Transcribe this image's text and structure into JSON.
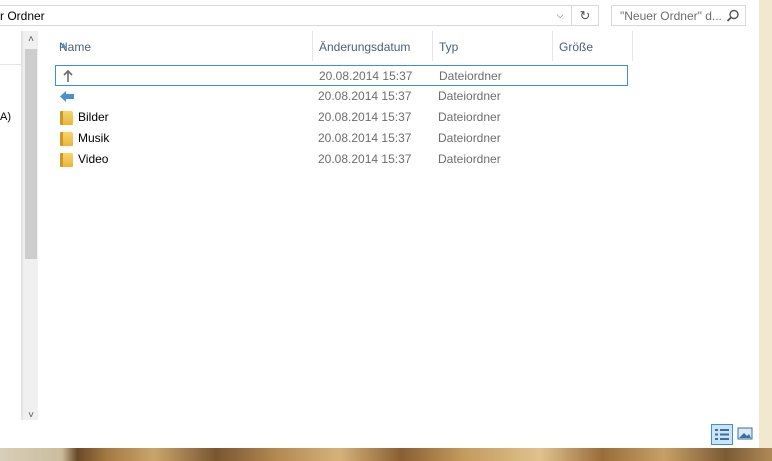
{
  "address": {
    "path_text": "r Ordner"
  },
  "search": {
    "placeholder": "\"Neuer Ordner\" d..."
  },
  "nav": {
    "partial_label": "A)"
  },
  "columns": [
    {
      "label": "Name"
    },
    {
      "label": "Änderungsdatum"
    },
    {
      "label": "Typ"
    },
    {
      "label": "Größe"
    }
  ],
  "rows": [
    {
      "name": "",
      "date": "20.08.2014 15:37",
      "type": "Dateiordner",
      "icon": "up-arrow-icon"
    },
    {
      "name": "",
      "date": "20.08.2014 15:37",
      "type": "Dateiordner",
      "icon": "back-arrow-icon"
    },
    {
      "name": "Bilder",
      "date": "20.08.2014 15:37",
      "type": "Dateiordner",
      "icon": "folder-icon"
    },
    {
      "name": "Musik",
      "date": "20.08.2014 15:37",
      "type": "Dateiordner",
      "icon": "folder-icon"
    },
    {
      "name": "Video",
      "date": "20.08.2014 15:37",
      "type": "Dateiordner",
      "icon": "folder-icon"
    }
  ],
  "colors": {
    "accent": "#3c8fdb",
    "header_text": "#4c607a"
  }
}
